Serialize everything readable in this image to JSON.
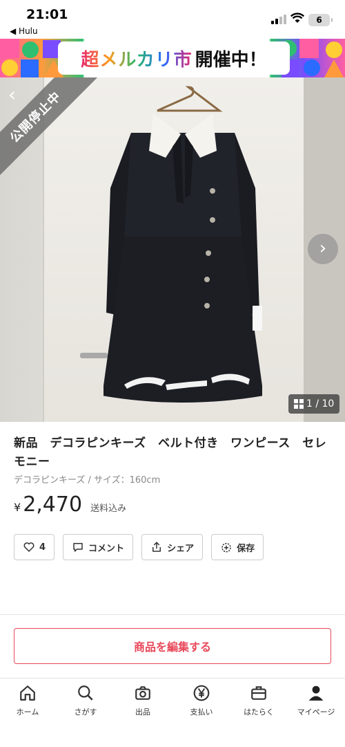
{
  "status_bar": {
    "time": "21:01",
    "back_app": "◀ Hulu",
    "battery": "6"
  },
  "banner": {
    "title": "超メルカリ市",
    "subtitle": "開催中！"
  },
  "photo": {
    "paused_label": "公開停止中",
    "counter": "1 / 10"
  },
  "item": {
    "title": "新品　デコラピンキーズ　ベルト付き　ワンピース　セレモニー",
    "subtitle": "デコラピンキーズ / サイズ：160cm",
    "price_symbol": "¥",
    "price": "2,470",
    "shipping_note": "送料込み"
  },
  "actions": {
    "like_count": "4",
    "comment": "コメント",
    "share": "シェア",
    "save": "保存"
  },
  "edit_button": "商品を編集する",
  "bottom_nav": [
    {
      "label": "ホーム",
      "icon": "home-icon"
    },
    {
      "label": "さがす",
      "icon": "search-icon"
    },
    {
      "label": "出品",
      "icon": "camera-icon"
    },
    {
      "label": "支払い",
      "icon": "yen-icon"
    },
    {
      "label": "はたらく",
      "icon": "briefcase-icon"
    },
    {
      "label": "マイページ",
      "icon": "person-icon"
    }
  ],
  "colors": {
    "accent": "#e8485a",
    "muted_text": "#888888"
  }
}
